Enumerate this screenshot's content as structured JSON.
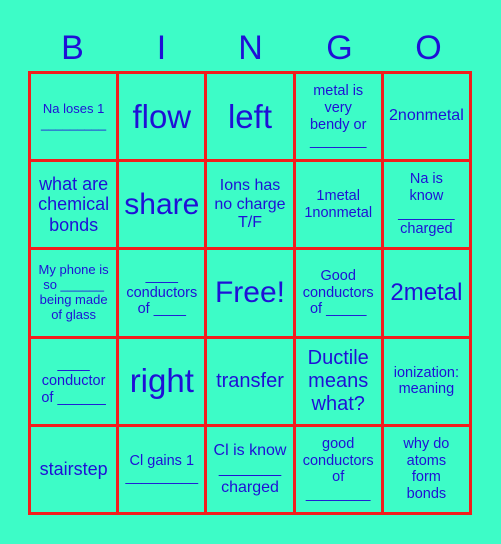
{
  "header": {
    "letters": [
      "B",
      "I",
      "N",
      "G",
      "O"
    ]
  },
  "colors": {
    "background": "#3dfcc7",
    "grid": "#f21d1d",
    "text": "#1f10d6"
  },
  "cells": [
    [
      "Na loses 1\n_________",
      "flow",
      "left",
      "metal is\nvery\nbendy or\n_______",
      "2nonmetal"
    ],
    [
      "what are\nchemical\nbonds",
      "share",
      "Ions has\nno charge\nT/F",
      "1metal\n1nonmetal",
      "Na is\nknow\n_______\ncharged"
    ],
    [
      "My phone is\nso ______\nbeing made\nof glass",
      "____\nconductors\nof ____",
      "Free!",
      "Good\nconductors\nof _____",
      "2metal"
    ],
    [
      "____\nconductor\nof ______",
      "right",
      "transfer",
      "Ductile\nmeans\nwhat?",
      "ionization:\nmeaning"
    ],
    [
      "stairstep",
      "Cl gains 1\n_________",
      "Cl is know\n_______\ncharged",
      "good\nconductors\nof\n________",
      "why do\natoms\nform\nbonds"
    ]
  ]
}
